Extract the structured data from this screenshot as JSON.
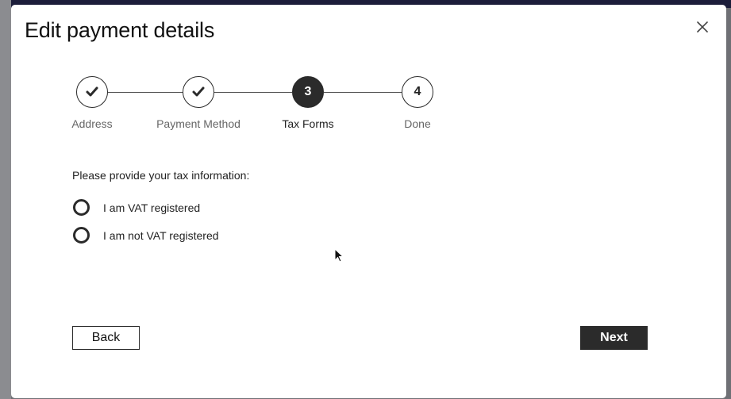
{
  "modal": {
    "title": "Edit payment details",
    "close_icon": "close-icon"
  },
  "stepper": {
    "steps": [
      {
        "label": "Address",
        "state": "completed",
        "marker": "check-icon"
      },
      {
        "label": "Payment Method",
        "state": "completed",
        "marker": "check-icon"
      },
      {
        "label": "Tax Forms",
        "state": "active",
        "number": "3"
      },
      {
        "label": "Done",
        "state": "upcoming",
        "number": "4"
      }
    ]
  },
  "form": {
    "prompt": "Please provide your tax information:",
    "options": [
      {
        "label": "I am VAT registered",
        "selected": false
      },
      {
        "label": "I am not VAT registered",
        "selected": false
      }
    ]
  },
  "footer": {
    "back_label": "Back",
    "next_label": "Next"
  },
  "colors": {
    "primary": "#2b2b2b",
    "background": "#ffffff",
    "muted_text": "#666666"
  }
}
